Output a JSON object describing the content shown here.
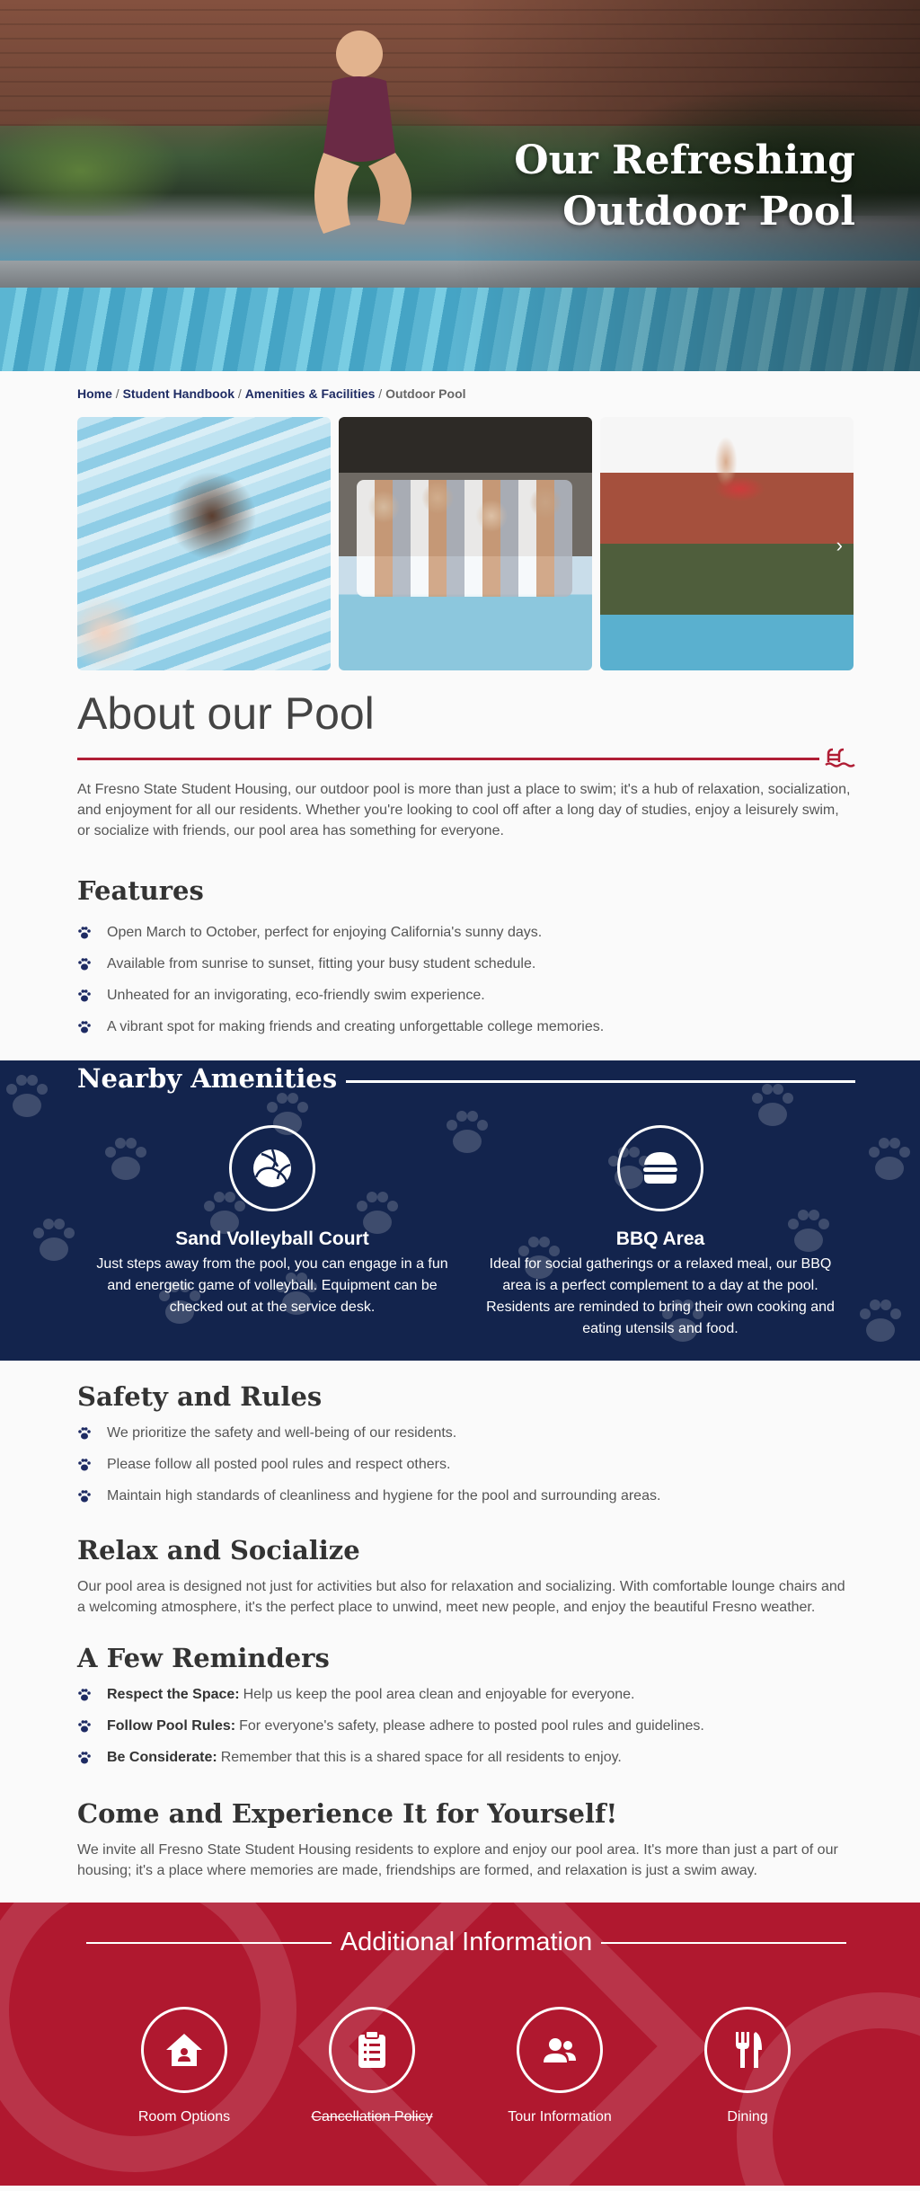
{
  "hero": {
    "title_line1": "Our Refreshing",
    "title_line2": "Outdoor Pool"
  },
  "breadcrumb": {
    "home": "Home",
    "handbook": "Student Handbook",
    "amenities": "Amenities & Facilities",
    "current": "Outdoor Pool",
    "separator": "/"
  },
  "gallery": {
    "next_icon": "chevron-right-icon"
  },
  "about": {
    "title": "About our Pool",
    "text": "At Fresno State Student Housing, our outdoor pool is more than just a place to swim; it's a hub of relaxation, socialization, and enjoyment for all our residents. Whether you're looking to cool off after a long day of studies, enjoy a leisurely swim, or socialize with friends, our pool area has something for everyone."
  },
  "features": {
    "title": "Features",
    "items": [
      "Open March to October, perfect for enjoying California's sunny days.",
      "Available from sunrise to sunset, fitting your busy student schedule.",
      "Unheated for an invigorating, eco-friendly swim experience.",
      "A vibrant spot for making friends and creating unforgettable college memories."
    ]
  },
  "nearby": {
    "title": "Nearby Amenities",
    "items": [
      {
        "name": "Sand Volleyball Court",
        "icon": "volleyball-icon",
        "desc": "Just steps away from the pool, you can engage in a fun and energetic game of volleyball. Equipment can be checked out at the service desk."
      },
      {
        "name": "BBQ Area",
        "icon": "burger-icon",
        "desc": "Ideal for social gatherings or a relaxed meal, our BBQ area is a perfect complement to a day at the pool. Residents are reminded to bring their own cooking and eating utensils and food."
      }
    ]
  },
  "safety": {
    "title": "Safety and Rules",
    "items": [
      "We prioritize the safety and well-being of our residents.",
      "Please follow all posted pool rules and respect others.",
      "Maintain high standards of cleanliness and hygiene for the pool and surrounding areas."
    ]
  },
  "relax": {
    "title": "Relax and Socialize",
    "text": "Our pool area is designed not just for activities but also for relaxation and socializing. With comfortable lounge chairs and a welcoming atmosphere, it's the perfect place to unwind, meet new people, and enjoy the beautiful Fresno weather."
  },
  "reminders": {
    "title": "A Few Reminders",
    "items": [
      {
        "lead": "Respect the Space:",
        "text": "Help us keep the pool area clean and enjoyable for everyone."
      },
      {
        "lead": "Follow Pool Rules:",
        "text": "For everyone's safety, please adhere to posted pool rules and guidelines."
      },
      {
        "lead": "Be Considerate:",
        "text": "Remember that this is a shared space for all residents to enjoy."
      }
    ]
  },
  "come": {
    "title": "Come and Experience It for Yourself!",
    "text": "We invite all Fresno State Student Housing residents to explore and enjoy our pool area. It's more than just a part of our housing; it's a place where memories are made, friendships are formed, and relaxation is just a swim away."
  },
  "additional": {
    "title": "Additional Information",
    "items": [
      {
        "label": "Room Options",
        "icon": "house-icon"
      },
      {
        "label": "Cancellation Policy",
        "icon": "clipboard-icon"
      },
      {
        "label": "Tour Information",
        "icon": "people-icon"
      },
      {
        "label": "Dining",
        "icon": "fork-knife-icon"
      }
    ]
  },
  "colors": {
    "navy": "#13244d",
    "crimson": "#b0182f",
    "link": "#1e2b63"
  }
}
